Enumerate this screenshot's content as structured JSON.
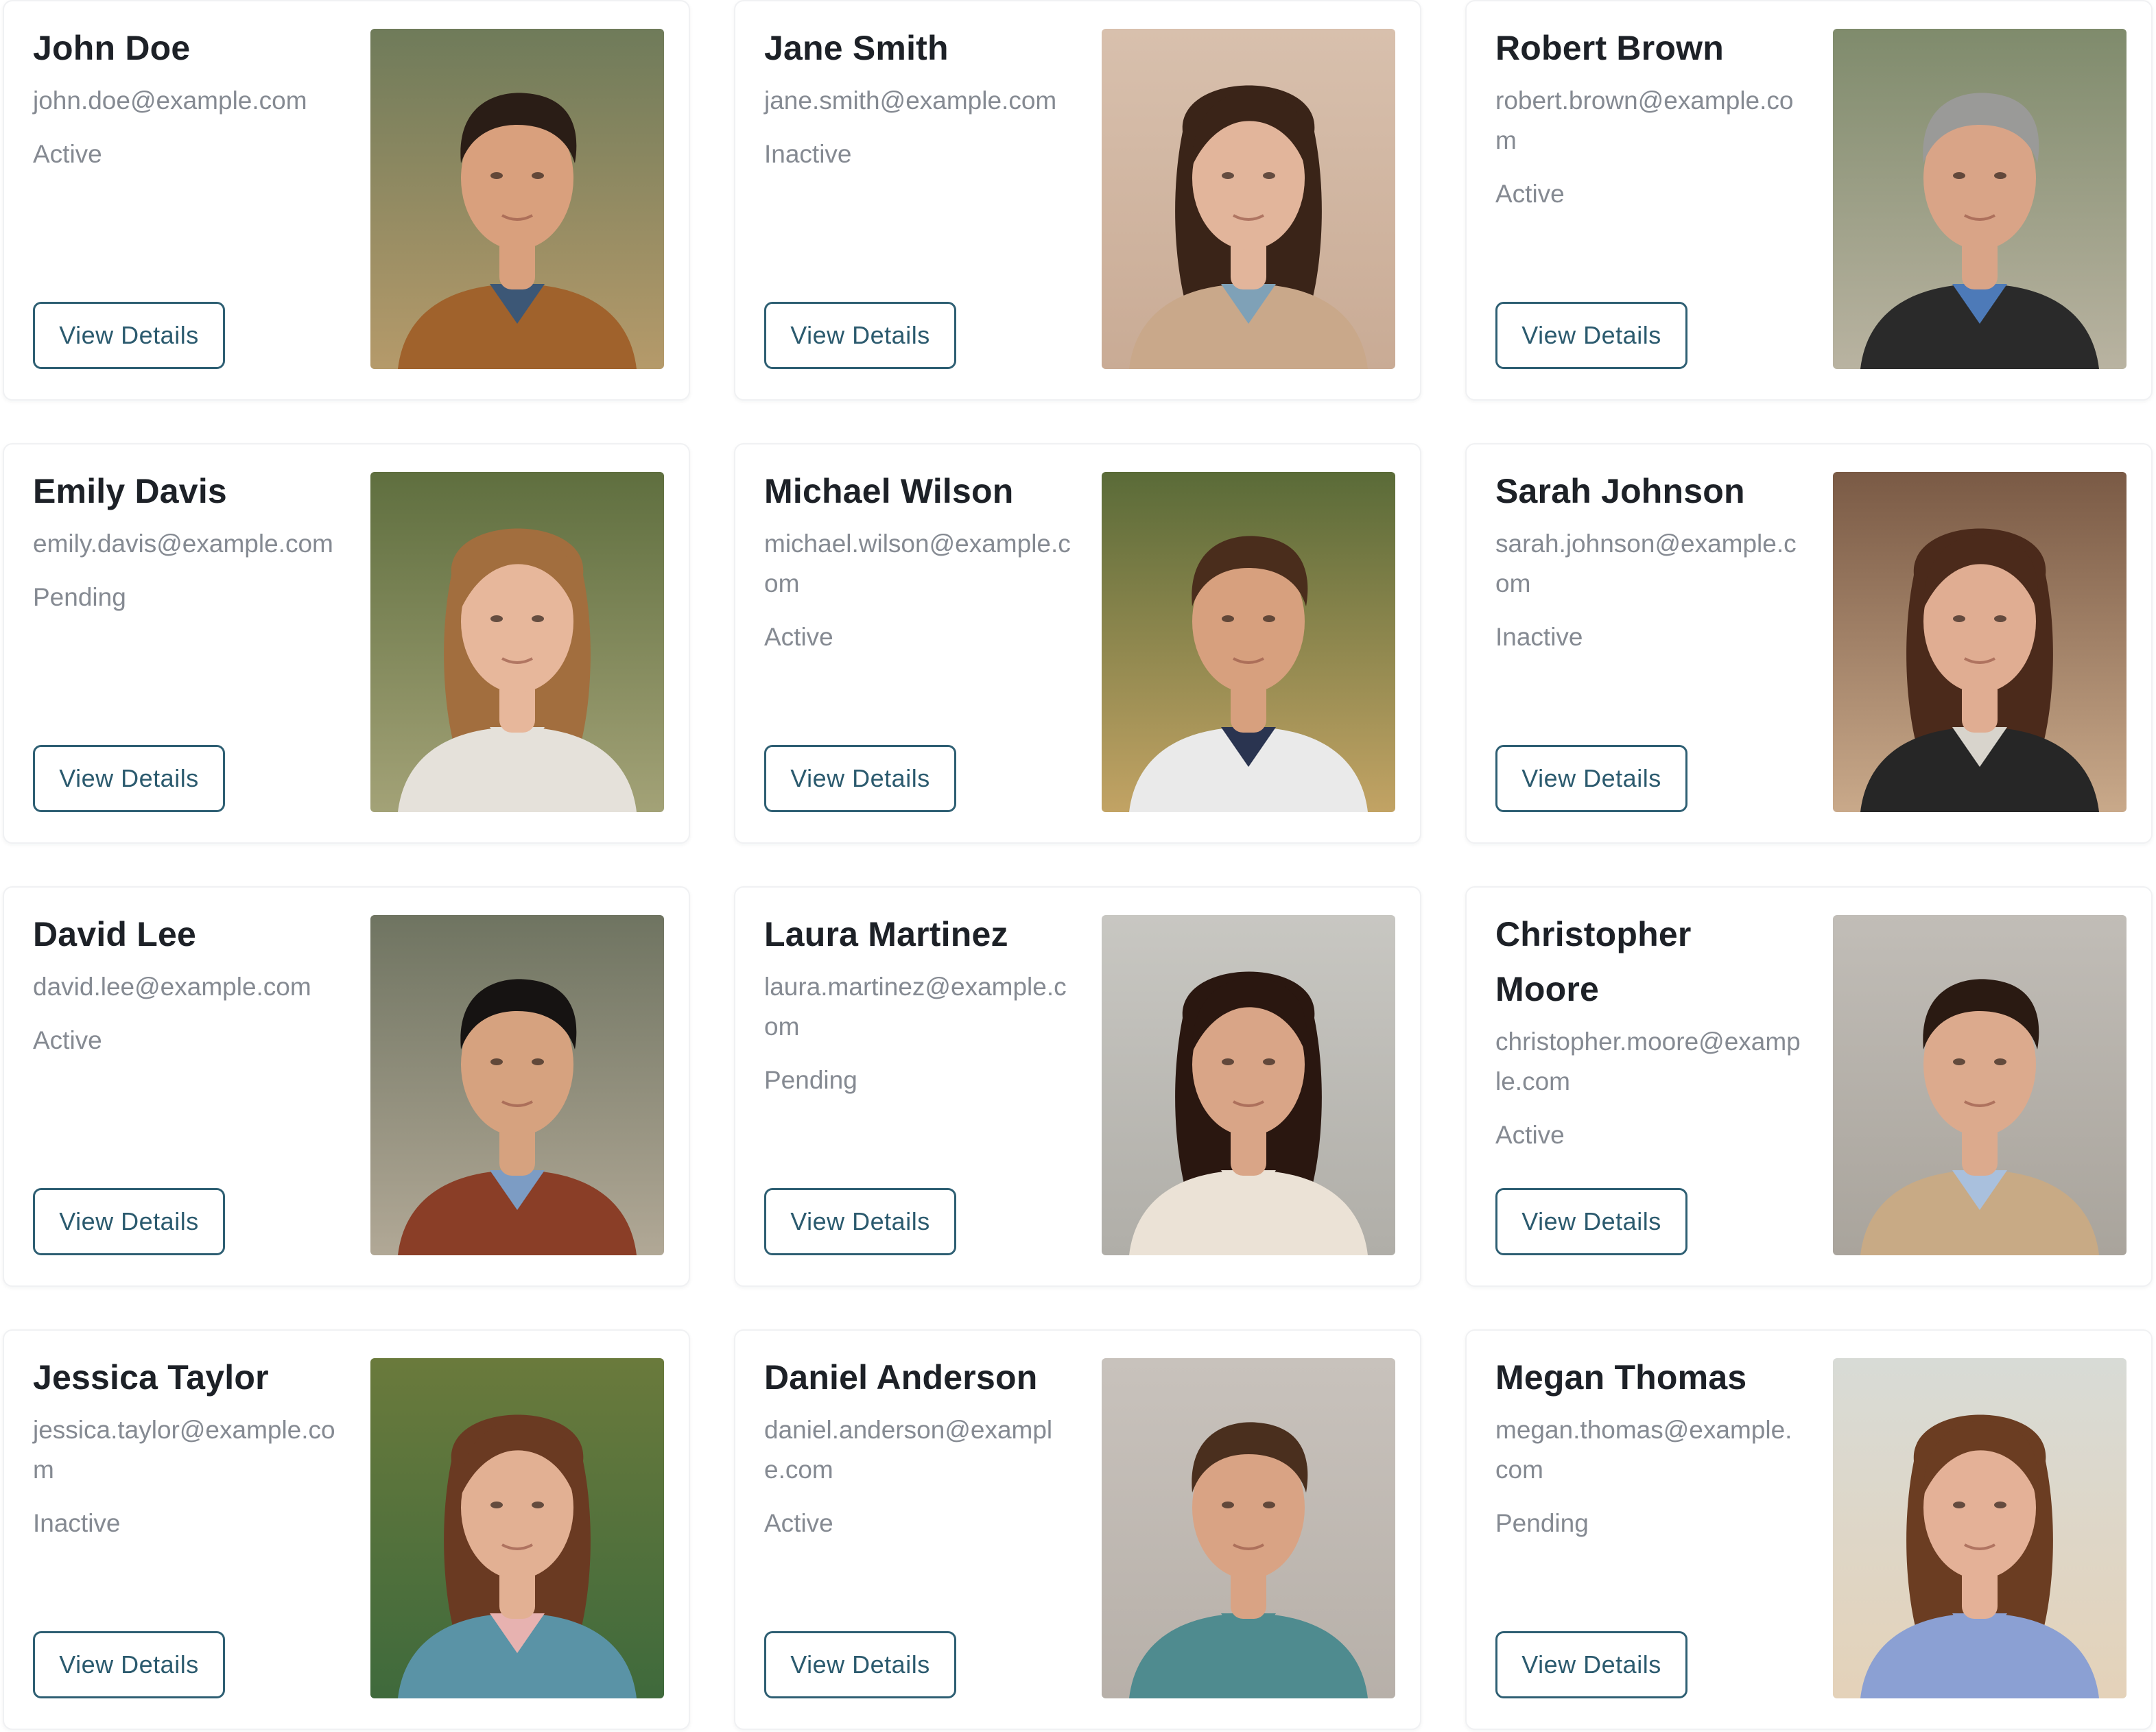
{
  "cards": [
    {
      "name": "John Doe",
      "email": "john.doe@example.com",
      "status": "Active",
      "button": "View Details",
      "photo": {
        "bg_top": "#6f7b5a",
        "bg_bottom": "#b59a6a",
        "skin": "#d9a07d",
        "hair": "#2a1d16",
        "hair_style": "short",
        "shirt": "#a0622c",
        "collar": "#3c5776"
      }
    },
    {
      "name": "Jane Smith",
      "email": "jane.smith@example.com",
      "status": "Inactive",
      "button": "View Details",
      "photo": {
        "bg_top": "#d8c0ad",
        "bg_bottom": "#c9ab95",
        "skin": "#e2b59b",
        "hair": "#3a2418",
        "hair_style": "long",
        "shirt": "#c9a88a",
        "collar": "#7fa1b7"
      }
    },
    {
      "name": "Robert Brown",
      "email": "robert.brown@example.com",
      "status": "Active",
      "button": "View Details",
      "photo": {
        "bg_top": "#7f8b6c",
        "bg_bottom": "#b9b3a1",
        "skin": "#d9a487",
        "hair": "#9a9a98",
        "hair_style": "short",
        "shirt": "#2a2a2a",
        "collar": "#4d7ab8"
      }
    },
    {
      "name": "Emily Davis",
      "email": "emily.davis@example.com",
      "status": "Pending",
      "button": "View Details",
      "photo": {
        "bg_top": "#5f6f3f",
        "bg_bottom": "#a3a277",
        "skin": "#e7b79b",
        "hair": "#a26e3e",
        "hair_style": "long",
        "shirt": "#e5e1da",
        "collar": "#e5e1da"
      }
    },
    {
      "name": "Michael Wilson",
      "email": "michael.wilson@example.com",
      "status": "Active",
      "button": "View Details",
      "photo": {
        "bg_top": "#5a6b38",
        "bg_bottom": "#c2a364",
        "skin": "#d7a07e",
        "hair": "#4a2d1c",
        "hair_style": "short",
        "shirt": "#eaeaea",
        "collar": "#2a3450"
      }
    },
    {
      "name": "Sarah Johnson",
      "email": "sarah.johnson@example.com",
      "status": "Inactive",
      "button": "View Details",
      "photo": {
        "bg_top": "#7a5a45",
        "bg_bottom": "#c9a98a",
        "skin": "#e0ad92",
        "hair": "#4b2a1b",
        "hair_style": "long",
        "shirt": "#262626",
        "collar": "#d8d4cc"
      }
    },
    {
      "name": "David Lee",
      "email": "david.lee@example.com",
      "status": "Active",
      "button": "View Details",
      "photo": {
        "bg_top": "#6f7461",
        "bg_bottom": "#b1a896",
        "skin": "#d6a27f",
        "hair": "#161312",
        "hair_style": "short",
        "shirt": "#8a3e27",
        "collar": "#7c9cc4"
      }
    },
    {
      "name": "Laura Martinez",
      "email": "laura.martinez@example.com",
      "status": "Pending",
      "button": "View Details",
      "photo": {
        "bg_top": "#c8c7c2",
        "bg_bottom": "#b0aea8",
        "skin": "#d9a587",
        "hair": "#2a1710",
        "hair_style": "long",
        "shirt": "#ebe2d6",
        "collar": "#ebe2d6"
      }
    },
    {
      "name": "Christopher Moore",
      "email": "christopher.moore@example.com",
      "status": "Active",
      "button": "View Details",
      "photo": {
        "bg_top": "#c1bdb7",
        "bg_bottom": "#a9a49c",
        "skin": "#dcaa8d",
        "hair": "#2a1a12",
        "hair_style": "short",
        "shirt": "#c8aa85",
        "collar": "#a9c0dd"
      }
    },
    {
      "name": "Jessica Taylor",
      "email": "jessica.taylor@example.com",
      "status": "Inactive",
      "button": "View Details",
      "photo": {
        "bg_top": "#6a7a3c",
        "bg_bottom": "#3f6a3c",
        "skin": "#e2b093",
        "hair": "#6a3a22",
        "hair_style": "long",
        "shirt": "#5a93a6",
        "collar": "#e7b2b0"
      }
    },
    {
      "name": "Daniel Anderson",
      "email": "daniel.anderson@example.com",
      "status": "Active",
      "button": "View Details",
      "photo": {
        "bg_top": "#c8c2bc",
        "bg_bottom": "#b7b0a9",
        "skin": "#d9a384",
        "hair": "#4a2f1e",
        "hair_style": "short",
        "shirt": "#4f8b8f",
        "collar": "#4f8b8f"
      }
    },
    {
      "name": "Megan Thomas",
      "email": "megan.thomas@example.com",
      "status": "Pending",
      "button": "View Details",
      "photo": {
        "bg_top": "#d8dbd6",
        "bg_bottom": "#e4d2b9",
        "skin": "#e4b197",
        "hair": "#6b3d22",
        "hair_style": "long",
        "shirt": "#8ba0d3",
        "collar": "#8ba0d3"
      }
    }
  ]
}
